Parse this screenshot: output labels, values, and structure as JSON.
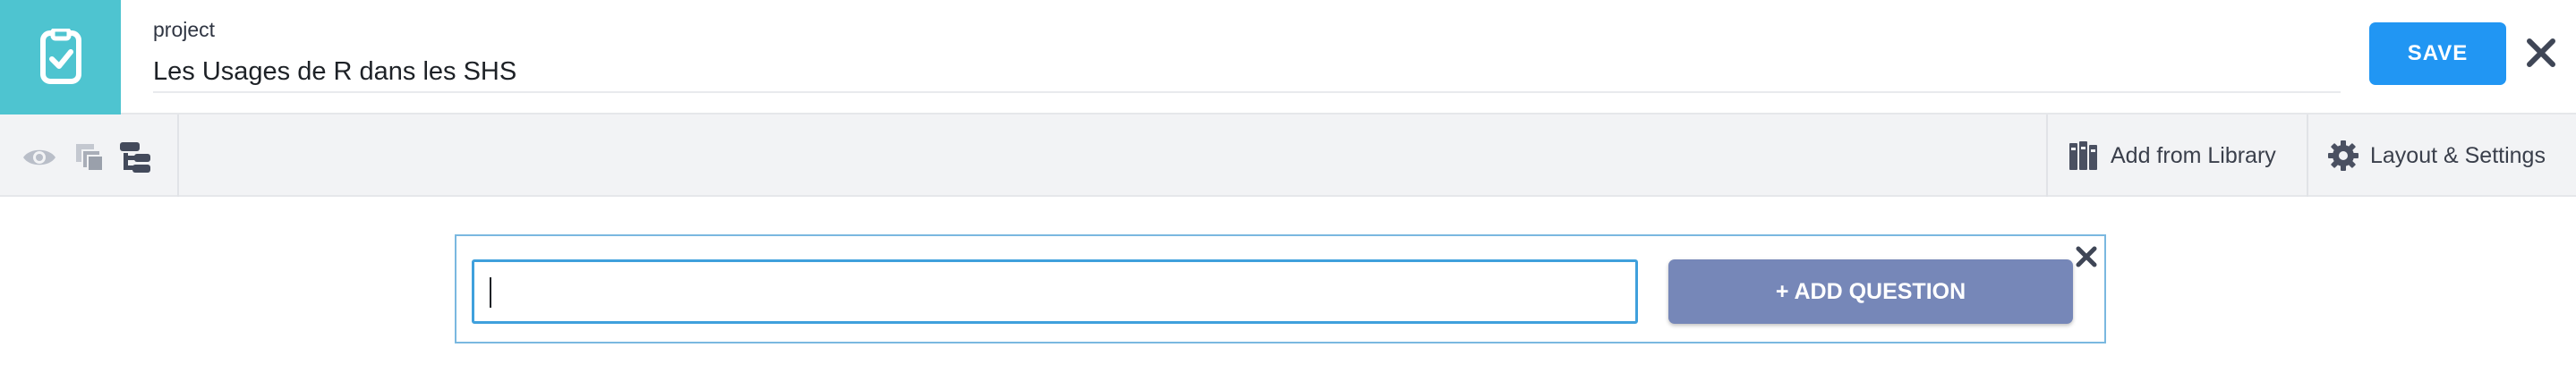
{
  "header": {
    "section_label": "project",
    "title_value": "Les Usages de R dans les SHS",
    "save_label": "SAVE",
    "logo_icon": "clipboard-check-icon",
    "close_icon": "close-icon"
  },
  "toolbar": {
    "left_icons": [
      "eye-icon",
      "copy-icon",
      "tree-structure-icon"
    ],
    "library_label": "Add from Library",
    "library_icon": "library-icon",
    "settings_label": "Layout & Settings",
    "settings_icon": "gear-icon"
  },
  "add_question": {
    "input_value": "",
    "button_label": "+ ADD QUESTION",
    "close_icon": "close-icon"
  },
  "colors": {
    "brand_teal": "#4ec4d0",
    "save_blue": "#2196f3",
    "add_button": "#7687b8",
    "input_border": "#3fa0dc",
    "panel_border": "#7ab8e0"
  }
}
